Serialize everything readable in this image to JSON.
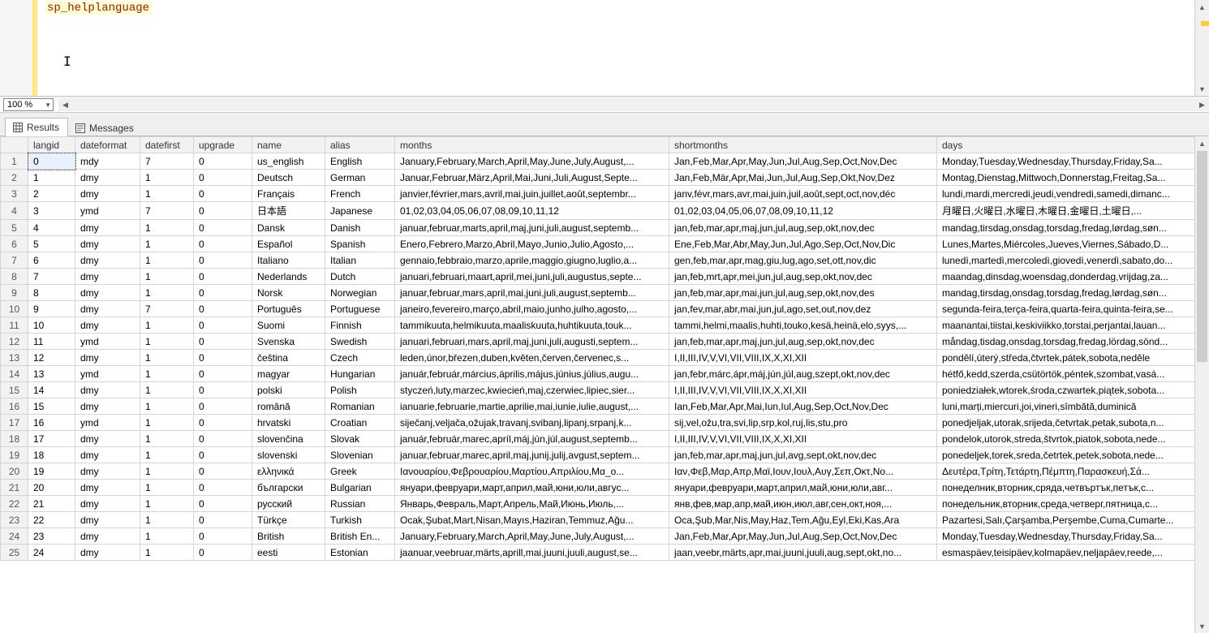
{
  "editor": {
    "query_text": "sp_helplanguage",
    "zoom": "100 %"
  },
  "tabs": {
    "results": "Results",
    "messages": "Messages"
  },
  "columns": [
    "langid",
    "dateformat",
    "datefirst",
    "upgrade",
    "name",
    "alias",
    "months",
    "shortmonths",
    "days"
  ],
  "rows": [
    {
      "langid": "0",
      "dateformat": "mdy",
      "datefirst": "7",
      "upgrade": "0",
      "name": "us_english",
      "alias": "English",
      "months": "January,February,March,April,May,June,July,August,...",
      "shortmonths": "Jan,Feb,Mar,Apr,May,Jun,Jul,Aug,Sep,Oct,Nov,Dec",
      "days": "Monday,Tuesday,Wednesday,Thursday,Friday,Sa..."
    },
    {
      "langid": "1",
      "dateformat": "dmy",
      "datefirst": "1",
      "upgrade": "0",
      "name": "Deutsch",
      "alias": "German",
      "months": "Januar,Februar,März,April,Mai,Juni,Juli,August,Septe...",
      "shortmonths": "Jan,Feb,Mär,Apr,Mai,Jun,Jul,Aug,Sep,Okt,Nov,Dez",
      "days": "Montag,Dienstag,Mittwoch,Donnerstag,Freitag,Sa..."
    },
    {
      "langid": "2",
      "dateformat": "dmy",
      "datefirst": "1",
      "upgrade": "0",
      "name": "Français",
      "alias": "French",
      "months": "janvier,février,mars,avril,mai,juin,juillet,août,septembr...",
      "shortmonths": "janv,févr,mars,avr,mai,juin,juil,août,sept,oct,nov,déc",
      "days": "lundi,mardi,mercredi,jeudi,vendredi,samedi,dimanc..."
    },
    {
      "langid": "3",
      "dateformat": "ymd",
      "datefirst": "7",
      "upgrade": "0",
      "name": "日本語",
      "alias": "Japanese",
      "months": "01,02,03,04,05,06,07,08,09,10,11,12",
      "shortmonths": "01,02,03,04,05,06,07,08,09,10,11,12",
      "days": "月曜日,火曜日,水曜日,木曜日,金曜日,土曜日,..."
    },
    {
      "langid": "4",
      "dateformat": "dmy",
      "datefirst": "1",
      "upgrade": "0",
      "name": "Dansk",
      "alias": "Danish",
      "months": "januar,februar,marts,april,maj,juni,juli,august,septemb...",
      "shortmonths": "jan,feb,mar,apr,maj,jun,jul,aug,sep,okt,nov,dec",
      "days": "mandag,tirsdag,onsdag,torsdag,fredag,lørdag,søn..."
    },
    {
      "langid": "5",
      "dateformat": "dmy",
      "datefirst": "1",
      "upgrade": "0",
      "name": "Español",
      "alias": "Spanish",
      "months": "Enero,Febrero,Marzo,Abril,Mayo,Junio,Julio,Agosto,...",
      "shortmonths": "Ene,Feb,Mar,Abr,May,Jun,Jul,Ago,Sep,Oct,Nov,Dic",
      "days": "Lunes,Martes,Miércoles,Jueves,Viernes,Sábado,D..."
    },
    {
      "langid": "6",
      "dateformat": "dmy",
      "datefirst": "1",
      "upgrade": "0",
      "name": "Italiano",
      "alias": "Italian",
      "months": "gennaio,febbraio,marzo,aprile,maggio,giugno,luglio,a...",
      "shortmonths": "gen,feb,mar,apr,mag,giu,lug,ago,set,ott,nov,dic",
      "days": "lunedì,martedì,mercoledì,giovedì,venerdì,sabato,do..."
    },
    {
      "langid": "7",
      "dateformat": "dmy",
      "datefirst": "1",
      "upgrade": "0",
      "name": "Nederlands",
      "alias": "Dutch",
      "months": "januari,februari,maart,april,mei,juni,juli,augustus,septe...",
      "shortmonths": "jan,feb,mrt,apr,mei,jun,jul,aug,sep,okt,nov,dec",
      "days": "maandag,dinsdag,woensdag,donderdag,vrijdag,za..."
    },
    {
      "langid": "8",
      "dateformat": "dmy",
      "datefirst": "1",
      "upgrade": "0",
      "name": "Norsk",
      "alias": "Norwegian",
      "months": "januar,februar,mars,april,mai,juni,juli,august,septemb...",
      "shortmonths": "jan,feb,mar,apr,mai,jun,jul,aug,sep,okt,nov,des",
      "days": "mandag,tirsdag,onsdag,torsdag,fredag,lørdag,søn..."
    },
    {
      "langid": "9",
      "dateformat": "dmy",
      "datefirst": "7",
      "upgrade": "0",
      "name": "Português",
      "alias": "Portuguese",
      "months": "janeiro,fevereiro,março,abril,maio,junho,julho,agosto,...",
      "shortmonths": "jan,fev,mar,abr,mai,jun,jul,ago,set,out,nov,dez",
      "days": "segunda-feira,terça-feira,quarta-feira,quinta-feira,se..."
    },
    {
      "langid": "10",
      "dateformat": "dmy",
      "datefirst": "1",
      "upgrade": "0",
      "name": "Suomi",
      "alias": "Finnish",
      "months": "tammikuuta,helmikuuta,maaliskuuta,huhtikuuta,touk...",
      "shortmonths": "tammi,helmi,maalis,huhti,touko,kesä,heinä,elo,syys,...",
      "days": "maanantai,tiistai,keskiviikko,torstai,perjantai,lauan..."
    },
    {
      "langid": "11",
      "dateformat": "ymd",
      "datefirst": "1",
      "upgrade": "0",
      "name": "Svenska",
      "alias": "Swedish",
      "months": "januari,februari,mars,april,maj,juni,juli,augusti,septem...",
      "shortmonths": "jan,feb,mar,apr,maj,jun,jul,aug,sep,okt,nov,dec",
      "days": "måndag,tisdag,onsdag,torsdag,fredag,lördag,sönd..."
    },
    {
      "langid": "12",
      "dateformat": "dmy",
      "datefirst": "1",
      "upgrade": "0",
      "name": "čeština",
      "alias": "Czech",
      "months": "leden,únor,březen,duben,květen,červen,červenec,s...",
      "shortmonths": "I,II,III,IV,V,VI,VII,VIII,IX,X,XI,XII",
      "days": "pondělí,úterý,středa,čtvrtek,pátek,sobota,neděle"
    },
    {
      "langid": "13",
      "dateformat": "ymd",
      "datefirst": "1",
      "upgrade": "0",
      "name": "magyar",
      "alias": "Hungarian",
      "months": "január,február,március,április,május,június,július,augu...",
      "shortmonths": "jan,febr,márc,ápr,máj,jún,júl,aug,szept,okt,nov,dec",
      "days": "hétfő,kedd,szerda,csütörtök,péntek,szombat,vasá..."
    },
    {
      "langid": "14",
      "dateformat": "dmy",
      "datefirst": "1",
      "upgrade": "0",
      "name": "polski",
      "alias": "Polish",
      "months": "styczeń,luty,marzec,kwiecień,maj,czerwiec,lipiec,sier...",
      "shortmonths": "I,II,III,IV,V,VI,VII,VIII,IX,X,XI,XII",
      "days": "poniedziałek,wtorek,środa,czwartek,piątek,sobota..."
    },
    {
      "langid": "15",
      "dateformat": "dmy",
      "datefirst": "1",
      "upgrade": "0",
      "name": "română",
      "alias": "Romanian",
      "months": "ianuarie,februarie,martie,aprilie,mai,iunie,iulie,august,...",
      "shortmonths": "Ian,Feb,Mar,Apr,Mai,Iun,Iul,Aug,Sep,Oct,Nov,Dec",
      "days": "luni,marți,miercuri,joi,vineri,sîmbătă,duminică"
    },
    {
      "langid": "16",
      "dateformat": "ymd",
      "datefirst": "1",
      "upgrade": "0",
      "name": "hrvatski",
      "alias": "Croatian",
      "months": "siječanj,veljača,ožujak,travanj,svibanj,lipanj,srpanj,k...",
      "shortmonths": "sij,vel,ožu,tra,svi,lip,srp,kol,ruj,lis,stu,pro",
      "days": "ponedjeljak,utorak,srijeda,četvrtak,petak,subota,n..."
    },
    {
      "langid": "17",
      "dateformat": "dmy",
      "datefirst": "1",
      "upgrade": "0",
      "name": "slovenčina",
      "alias": "Slovak",
      "months": "január,február,marec,apríl,máj,jún,júl,august,septemb...",
      "shortmonths": "I,II,III,IV,V,VI,VII,VIII,IX,X,XI,XII",
      "days": "pondelok,utorok,streda,štvrtok,piatok,sobota,nede..."
    },
    {
      "langid": "18",
      "dateformat": "dmy",
      "datefirst": "1",
      "upgrade": "0",
      "name": "slovenski",
      "alias": "Slovenian",
      "months": "januar,februar,marec,april,maj,junij,julij,avgust,septem...",
      "shortmonths": "jan,feb,mar,apr,maj,jun,jul,avg,sept,okt,nov,dec",
      "days": "ponedeljek,torek,sreda,četrtek,petek,sobota,nede..."
    },
    {
      "langid": "19",
      "dateformat": "dmy",
      "datefirst": "1",
      "upgrade": "0",
      "name": "ελληνικά",
      "alias": "Greek",
      "months": "Ιανουαρίου,Φεβρουαρίου,Μαρτίου,Απριλίου,Μα_ο...",
      "shortmonths": "Ιαν,Φεβ,Μαρ,Απρ,Μαϊ,Ιουν,Ιουλ,Αυγ,Σεπ,Οκτ,Νο...",
      "days": "Δευτέρα,Τρίτη,Τετάρτη,Πέμπτη,Παρασκευή,Σά..."
    },
    {
      "langid": "20",
      "dateformat": "dmy",
      "datefirst": "1",
      "upgrade": "0",
      "name": "български",
      "alias": "Bulgarian",
      "months": "януари,февруари,март,април,май,юни,юли,авгус...",
      "shortmonths": "януари,февруари,март,април,май,юни,юли,авг...",
      "days": "понеделник,вторник,сряда,четвъртък,петък,с..."
    },
    {
      "langid": "21",
      "dateformat": "dmy",
      "datefirst": "1",
      "upgrade": "0",
      "name": "русский",
      "alias": "Russian",
      "months": "Январь,Февраль,Март,Апрель,Май,Июнь,Июль,...",
      "shortmonths": "янв,фев,мар,апр,май,июн,июл,авг,сен,окт,ноя,...",
      "days": "понедельник,вторник,среда,четверг,пятница,с..."
    },
    {
      "langid": "22",
      "dateformat": "dmy",
      "datefirst": "1",
      "upgrade": "0",
      "name": "Türkçe",
      "alias": "Turkish",
      "months": "Ocak,Şubat,Mart,Nisan,Mayıs,Haziran,Temmuz,Ağu...",
      "shortmonths": "Oca,Şub,Mar,Nis,May,Haz,Tem,Ağu,Eyl,Eki,Kas,Ara",
      "days": "Pazartesi,Salı,Çarşamba,Perşembe,Cuma,Cumarte..."
    },
    {
      "langid": "23",
      "dateformat": "dmy",
      "datefirst": "1",
      "upgrade": "0",
      "name": "British",
      "alias": "British En...",
      "months": "January,February,March,April,May,June,July,August,...",
      "shortmonths": "Jan,Feb,Mar,Apr,May,Jun,Jul,Aug,Sep,Oct,Nov,Dec",
      "days": "Monday,Tuesday,Wednesday,Thursday,Friday,Sa..."
    },
    {
      "langid": "24",
      "dateformat": "dmy",
      "datefirst": "1",
      "upgrade": "0",
      "name": "eesti",
      "alias": "Estonian",
      "months": "jaanuar,veebruar,märts,aprill,mai,juuni,juuli,august,se...",
      "shortmonths": "jaan,veebr,märts,apr,mai,juuni,juuli,aug,sept,okt,no...",
      "days": "esmaspäev,teisipäev,kolmapäev,neljapäev,reede,..."
    }
  ]
}
